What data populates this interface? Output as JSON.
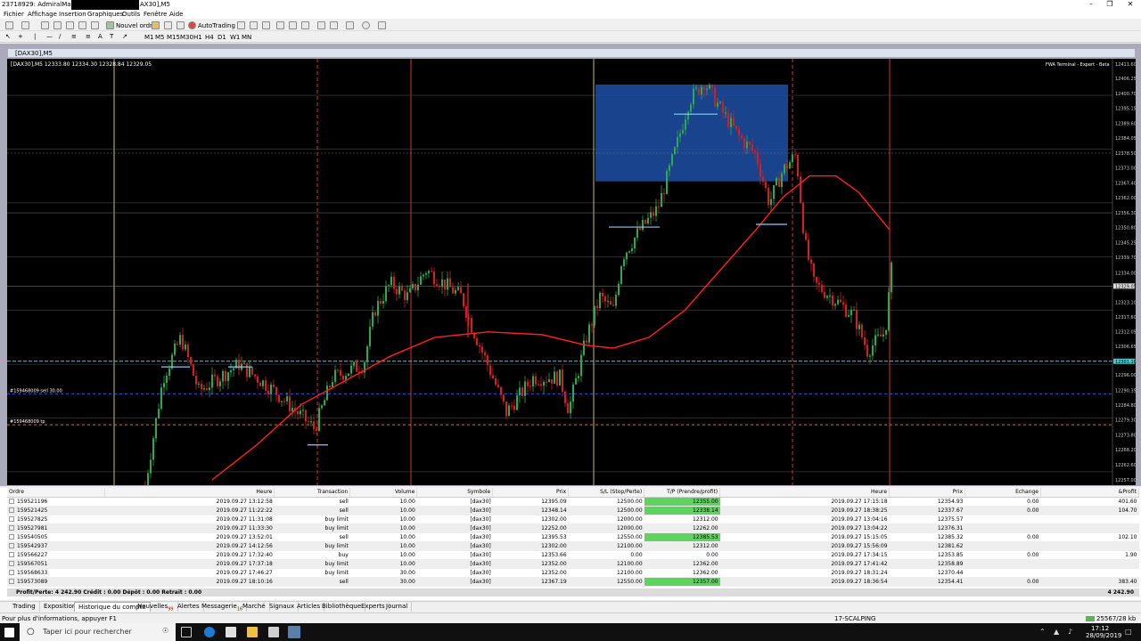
{
  "window": {
    "title_prefix": "23718929: AdmiralMarkets",
    "title_suffix": "AX30],M5"
  },
  "menu": [
    "Fichier",
    "Affichage",
    "Insertion",
    "Graphiques",
    "Outils",
    "Fenêtre",
    "Aide"
  ],
  "toolbar": {
    "new_order": "Nouvel ordre",
    "autotrading": "AutoTrading"
  },
  "timeframes": [
    "M1",
    "M5",
    "M15",
    "M30",
    "H1",
    "H4",
    "D1",
    "W1",
    "MN"
  ],
  "chart": {
    "tab_title": "[DAX30],M5",
    "header": "[DAX30],M5  12333.80 12334.30 12328.84 12329.05",
    "expert": "FWA Terminal - Expert - Beta",
    "price_ticks": [
      "12411.60",
      "12406.25",
      "12400.70",
      "12395.15",
      "12389.60",
      "12384.05",
      "12378.50",
      "12373.00",
      "12367.40",
      "12362.00",
      "12356.30",
      "12350.80",
      "12345.25",
      "12339.70",
      "12334.00",
      "12329.05",
      "12323.10",
      "12317.60",
      "12312.05",
      "12306.65",
      "12301.15",
      "12296.00",
      "12290.35",
      "12284.80",
      "12279.30",
      "12273.80",
      "12268.20",
      "12262.60",
      "12257.00"
    ],
    "current_price": "12329.05",
    "cyan_price": "12301.10",
    "order_labels": [
      "#159468009 sell 30.00",
      "#159468009 tp"
    ],
    "ma_color": "#ff2020",
    "bull_color": "#2fa84f",
    "bear_color": "#d22020"
  },
  "orders": {
    "columns": [
      "Ordre",
      "Heure",
      "Transaction",
      "Volume",
      "Symbole",
      "Prix",
      "S/L (Stop/Perte)",
      "T/P (Prendre/profit)",
      "Heure",
      "Prix",
      "Echange",
      "&Profit"
    ],
    "rows": [
      [
        "159521196",
        "2019.09.27 13:12:58",
        "sell",
        "10.00",
        "[dax30]",
        "12395.09",
        "12500.00",
        "12355.00",
        "2019.09.27 17:15:18",
        "12354.93",
        "0.00",
        "401.60"
      ],
      [
        "159521425",
        "2019.09.27 11:22:22",
        "sell",
        "10.00",
        "[dax30]",
        "12348.14",
        "12500.00",
        "12338.14",
        "2019.09.27 18:38:25",
        "12337.67",
        "0.00",
        "104.70"
      ],
      [
        "159527825",
        "2019.09.27 11:31:08",
        "buy limit",
        "10.00",
        "[dax30]",
        "12302.00",
        "12000.00",
        "12312.00",
        "2019.09.27 13:04:16",
        "12375.57",
        "",
        ""
      ],
      [
        "159527981",
        "2019.09.27 11:33:30",
        "buy limit",
        "10.00",
        "[dax30]",
        "12252.00",
        "12000.00",
        "12262.00",
        "2019.09.27 13:04:22",
        "12376.31",
        "",
        ""
      ],
      [
        "159540505",
        "2019.09.27 13:52:01",
        "sell",
        "10.00",
        "[dax30]",
        "12395.53",
        "12550.00",
        "12385.53",
        "2019.09.27 15:15:05",
        "12385.32",
        "0.00",
        "102.10"
      ],
      [
        "159542937",
        "2019.09.27 14:12:56",
        "buy limit",
        "10.00",
        "[dax30]",
        "12302.00",
        "12100.00",
        "12312.00",
        "2019.09.27 15:56:09",
        "12381.62",
        "",
        ""
      ],
      [
        "159566227",
        "2019.09.27 17:32:40",
        "buy",
        "10.00",
        "[dax30]",
        "12353.66",
        "0.00",
        "0.00",
        "2019.09.27 17:34:15",
        "12353.85",
        "0.00",
        "1.90"
      ],
      [
        "159567051",
        "2019.09.27 17:37:18",
        "buy limit",
        "10.00",
        "[dax30]",
        "12352.00",
        "12100.00",
        "12362.00",
        "2019.09.27 17:41:42",
        "12358.89",
        "",
        ""
      ],
      [
        "159568633",
        "2019.09.27 17:46:27",
        "buy limit",
        "30.00",
        "[dax30]",
        "12352.00",
        "12100.00",
        "12362.00",
        "2019.09.27 18:31:24",
        "12370.44",
        "",
        ""
      ],
      [
        "159573089",
        "2019.09.27 18:10:16",
        "sell",
        "30.00",
        "[dax30]",
        "12367.19",
        "12550.00",
        "12357.00",
        "2019.09.27 18:36:54",
        "12354.41",
        "0.00",
        "383.40"
      ]
    ],
    "tp_highlight_rows": [
      0,
      1,
      4,
      9
    ],
    "summary": "Profit/Perte: 4 242.90  Crédit : 0.00  Dépôt : 0.00  Retrait : 0.00",
    "summary_total": "4 242.90"
  },
  "tabs": [
    {
      "label": "Trading",
      "badge": ""
    },
    {
      "label": "Exposition",
      "badge": ""
    },
    {
      "label": "Historique du compte",
      "badge": "",
      "active": true
    },
    {
      "label": "Nouvelles",
      "badge": "99"
    },
    {
      "label": "Alertes",
      "badge": ""
    },
    {
      "label": "Messagerie",
      "badge": "16"
    },
    {
      "label": "Marché",
      "badge": ""
    },
    {
      "label": "Signaux",
      "badge": ""
    },
    {
      "label": "Articles",
      "badge": ""
    },
    {
      "label": "Bibliothèque",
      "badge": ""
    },
    {
      "label": "Experts",
      "badge": ""
    },
    {
      "label": "Journal",
      "badge": ""
    }
  ],
  "status": {
    "help": "Pour plus d'informations, appuyer F1",
    "profile": "17-SCALPING",
    "traffic": "25567/28 kb"
  },
  "taskbar": {
    "search_placeholder": "Taper ici pour rechercher",
    "time": "17:12",
    "date": "28/09/2019"
  }
}
